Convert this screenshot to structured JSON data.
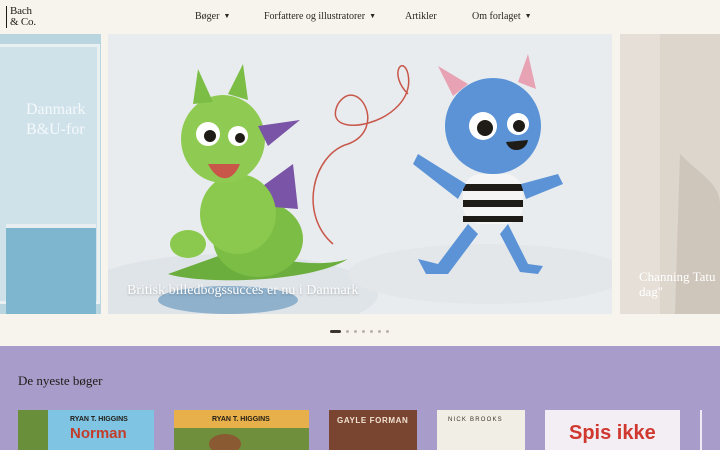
{
  "header": {
    "logo_line1": "Bach",
    "logo_line2": "& Co.",
    "nav": [
      {
        "label": "Bøger",
        "has_dropdown": true
      },
      {
        "label": "Forfattere og illustratorer",
        "has_dropdown": true
      },
      {
        "label": "Artikler",
        "has_dropdown": false
      },
      {
        "label": "Om forlaget",
        "has_dropdown": true
      }
    ]
  },
  "carousel": {
    "prev_slide_text": "Danmark B&U-for",
    "main_caption": "Britisk billedbogssucces er nu i Danmark",
    "next_caption_line1": "Channing Tatu",
    "next_caption_line2": "dag\"",
    "dot_count": 7,
    "active_dot": 1
  },
  "newest": {
    "title": "De nyeste bøger",
    "books": [
      {
        "author": "RYAN T. HIGGINS",
        "title": "Norman"
      },
      {
        "author": "RYAN T. HIGGINS",
        "title": ""
      },
      {
        "author": "GAYLE FORMAN",
        "title": ""
      },
      {
        "author": "NICK BROOKS",
        "title": ""
      },
      {
        "author": "",
        "title": "Spis ikke"
      }
    ]
  },
  "colors": {
    "background": "#f7f4ee",
    "books_section": "#a89ccb",
    "text": "#1f1b16"
  },
  "icons": [
    "chevron-down-icon"
  ]
}
